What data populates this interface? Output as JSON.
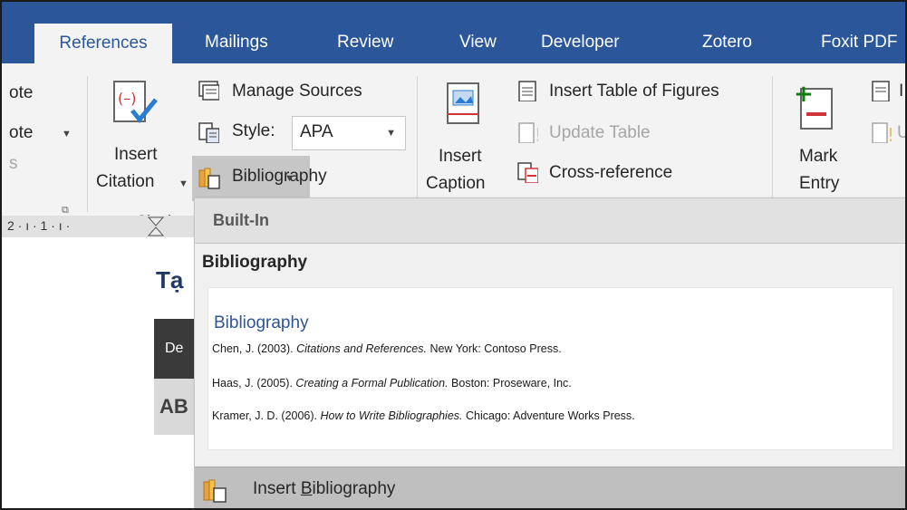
{
  "tabs": [
    {
      "id": "references",
      "label": "References",
      "active": true
    },
    {
      "id": "mailings",
      "label": "Mailings"
    },
    {
      "id": "review",
      "label": "Review"
    },
    {
      "id": "view",
      "label": "View"
    },
    {
      "id": "developer",
      "label": "Developer"
    },
    {
      "id": "zotero",
      "label": "Zotero"
    },
    {
      "id": "foxit",
      "label": "Foxit PDF"
    }
  ],
  "ribbon": {
    "footnote_partial_1": "ote",
    "footnote_partial_2": "ote",
    "footnote_partial_3": "s",
    "insert_citation": {
      "line1": "Insert",
      "line2": "Citation"
    },
    "manage_sources": "Manage Sources",
    "style_label": "Style:",
    "style_value": "APA",
    "bibliography": "Bibliography",
    "insert_caption": {
      "line1": "Insert",
      "line2": "Caption"
    },
    "insert_table_of_figures": "Insert Table of Figures",
    "update_table": "Update Table",
    "cross_reference": "Cross-reference",
    "mark_entry": {
      "line1": "Mark",
      "line2": "Entry"
    },
    "partial_right_1": "I",
    "partial_right_2": "U",
    "group_label_citations": "Citatic"
  },
  "ruler": {
    "marks": "2 · ı · 1 · ı ·"
  },
  "document": {
    "heading_partial": "Tạ",
    "table_head_partial": "De",
    "table_cell_partial": "AB"
  },
  "gallery": {
    "header": "Built-In",
    "item_title": "Bibliography",
    "preview_heading": "Bibliography",
    "entries": [
      {
        "author": "Chen, J. (2003).",
        "title": "Citations and References.",
        "rest": "New York: Contoso Press."
      },
      {
        "author": "Haas, J. (2005).",
        "title": "Creating a Formal Publication.",
        "rest": "Boston: Proseware, Inc."
      },
      {
        "author": "Kramer, J. D. (2006).",
        "title": "How to Write Bibliographies.",
        "rest": "Chicago: Adventure Works Press."
      }
    ],
    "footer_prefix": "Insert ",
    "footer_underlined": "B",
    "footer_suffix": "ibliography"
  },
  "colors": {
    "tabbar": "#2b579a",
    "ribbon": "#f3f3f3",
    "accent_red": "#d13438",
    "accent_green": "#107c10",
    "heading_blue": "#2f5496"
  }
}
